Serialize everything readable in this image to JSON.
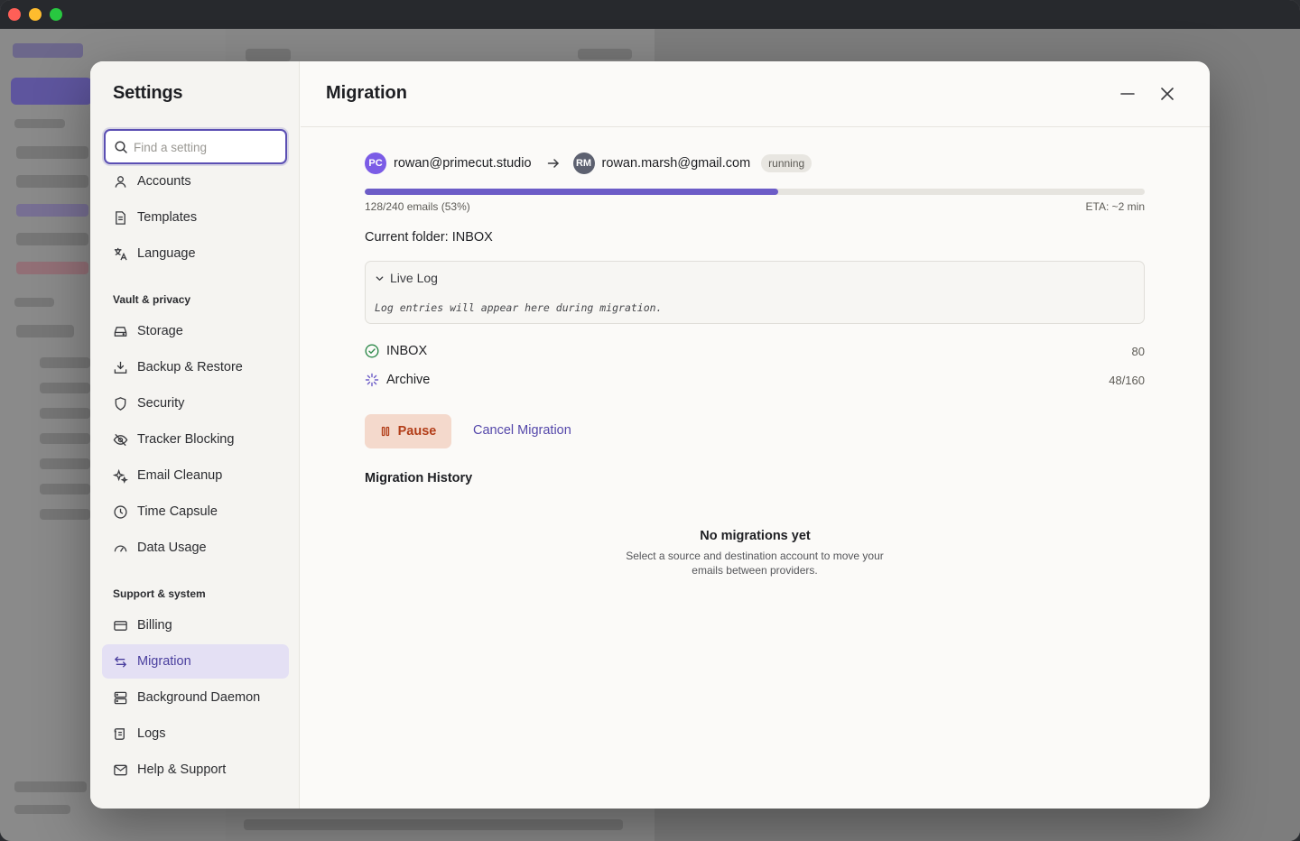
{
  "window": {
    "traffic_lights": [
      "close",
      "minimize",
      "zoom"
    ]
  },
  "settings": {
    "title": "Settings",
    "search_placeholder": "Find a setting",
    "nav": {
      "accounts": {
        "label": "Accounts",
        "icon": "user-icon"
      },
      "templates": {
        "label": "Templates",
        "icon": "document-icon"
      },
      "language": {
        "label": "Language",
        "icon": "translate-icon"
      },
      "section_vault": "Vault & privacy",
      "storage": {
        "label": "Storage",
        "icon": "drive-icon"
      },
      "backup": {
        "label": "Backup & Restore",
        "icon": "download-icon"
      },
      "security": {
        "label": "Security",
        "icon": "shield-icon"
      },
      "tracker": {
        "label": "Tracker Blocking",
        "icon": "eye-off-icon"
      },
      "cleanup": {
        "label": "Email Cleanup",
        "icon": "sparkles-icon"
      },
      "capsule": {
        "label": "Time Capsule",
        "icon": "clock-icon"
      },
      "usage": {
        "label": "Data Usage",
        "icon": "gauge-icon"
      },
      "section_support": "Support & system",
      "billing": {
        "label": "Billing",
        "icon": "credit-card-icon"
      },
      "migration": {
        "label": "Migration",
        "icon": "swap-icon",
        "active": true
      },
      "daemon": {
        "label": "Background Daemon",
        "icon": "server-icon"
      },
      "logs": {
        "label": "Logs",
        "icon": "scroll-icon"
      },
      "help": {
        "label": "Help & Support",
        "icon": "mail-icon"
      }
    }
  },
  "migration": {
    "title": "Migration",
    "source": {
      "initials": "PC",
      "email": "rowan@primecut.studio",
      "color": "#7b5ce6"
    },
    "destination": {
      "initials": "RM",
      "email": "rowan.marsh@gmail.com",
      "color": "#5d6170"
    },
    "status": "running",
    "progress_fraction": 0.53,
    "progress_label": "128/240 emails (53%)",
    "eta": "ETA: ~2 min",
    "current_folder": "Current folder: INBOX",
    "live_log": {
      "label": "Live Log",
      "placeholder": "Log entries will appear here during migration."
    },
    "folders": [
      {
        "name": "INBOX",
        "count": "80",
        "state": "done"
      },
      {
        "name": "Archive",
        "count": "48/160",
        "state": "in-progress"
      }
    ],
    "pause_label": "Pause",
    "cancel_label": "Cancel Migration",
    "history_title": "Migration History",
    "empty_title": "No migrations yet",
    "empty_desc": "Select a source and destination account to move your emails between providers."
  },
  "colors": {
    "accent": "#5b4fb3",
    "progress": "#6c5cc7",
    "pause_bg": "#f4d9cc",
    "pause_text": "#b23d18",
    "done_green": "#2f8a4c"
  }
}
